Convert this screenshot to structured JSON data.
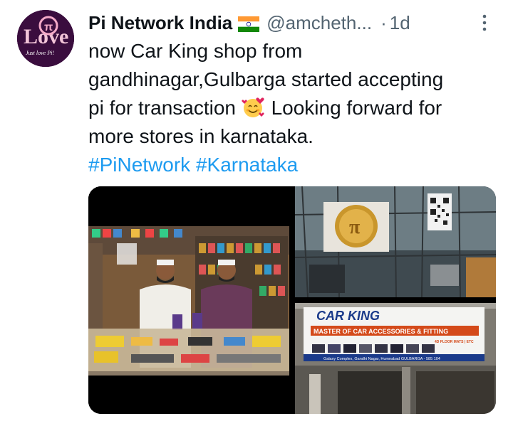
{
  "tweet": {
    "author_name": "Pi Network India",
    "handle": "@amcheth...",
    "separator": "·",
    "time": "1d",
    "text_lines": [
      "now Car King shop from",
      "gandhinagar,Gulbarga started accepting",
      "pi for transaction",
      "Looking forward for",
      "more stores in karnataka."
    ],
    "hashtags": [
      "#PiNetwork",
      "#Karnataka"
    ],
    "avatar_text": "Just love Pi!",
    "avatar_letters": "Love",
    "flag_icon": "india-flag-icon",
    "emoji_icon": "smiling-face-with-hearts-icon",
    "more_icon": "more-options-icon"
  },
  "media": {
    "shop_sign": {
      "title": "CAR KING",
      "subtitle": "MASTER OF CAR ACCESSORIES & FITTING",
      "floor_mats": "4D FLOOR MATS | ETC",
      "address": "Galaxy Complex, Gandhi Nagar, Humnabad GULBARGA - 585 104"
    }
  },
  "colors": {
    "hashtag": "#1d9bf0",
    "muted": "#536471",
    "text": "#0f1419"
  }
}
